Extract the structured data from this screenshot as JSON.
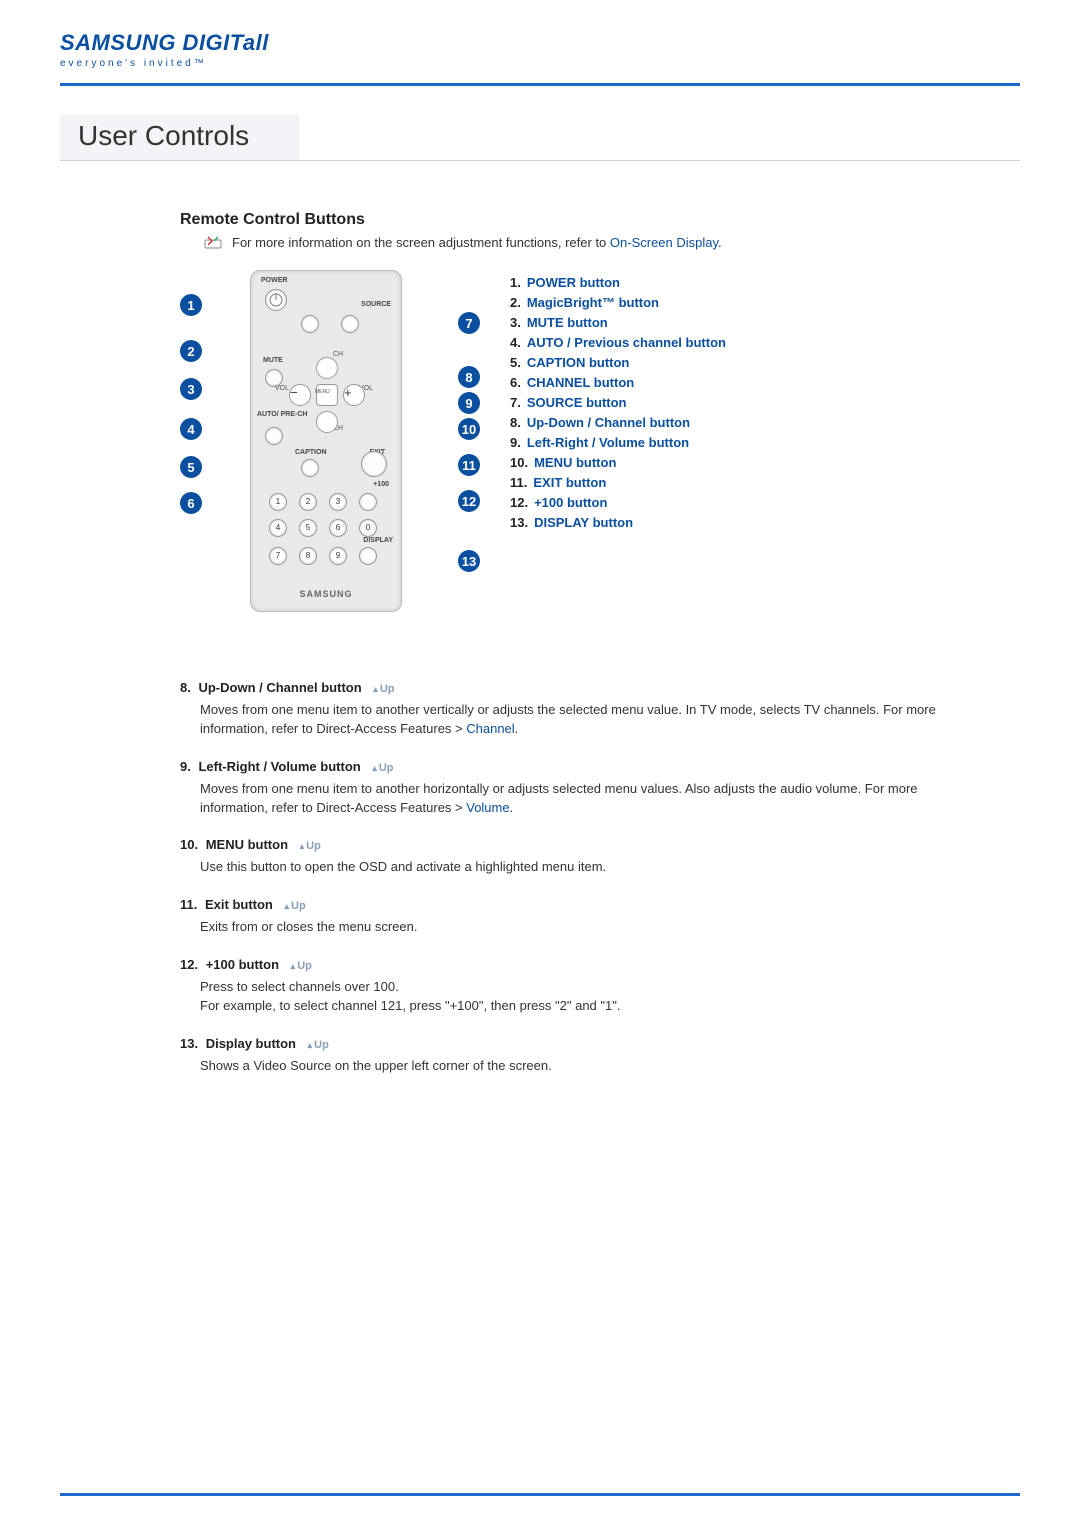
{
  "brand": {
    "logo_main": "SAMSUNG DIGITall",
    "logo_tag": "everyone's invited™"
  },
  "section_title": "User Controls",
  "subsection_title": "Remote Control Buttons",
  "note": {
    "text_before": "For more information on the screen adjustment functions, refer to ",
    "link": "On-Screen Display",
    "text_after": "."
  },
  "remote": {
    "label_power": "POWER",
    "label_source": "SOURCE",
    "label_mute": "MUTE",
    "label_auto": "AUTO/\nPRE-CH",
    "label_caption": "CAPTION",
    "label_exit": "EXIT",
    "label_plus100": "+100",
    "label_display": "DISPLAY",
    "label_ch": "CH",
    "label_vol": "VOL",
    "label_menu": "MENU",
    "brand": "SAMSUNG",
    "numpad": [
      "1",
      "2",
      "3",
      "4",
      "5",
      "6",
      "7",
      "8",
      "9",
      "0"
    ]
  },
  "callouts_left": [
    "1",
    "2",
    "3",
    "4",
    "5",
    "6"
  ],
  "callouts_right": [
    "7",
    "8",
    "9",
    "10",
    "11",
    "12",
    "13"
  ],
  "button_list": [
    {
      "n": "1.",
      "label": "POWER button"
    },
    {
      "n": "2.",
      "label": "MagicBright™ button"
    },
    {
      "n": "3.",
      "label": "MUTE button"
    },
    {
      "n": "4.",
      "label": "AUTO / Previous channel button"
    },
    {
      "n": "5.",
      "label": "CAPTION button"
    },
    {
      "n": "6.",
      "label": "CHANNEL button"
    },
    {
      "n": "7.",
      "label": "SOURCE button"
    },
    {
      "n": "8.",
      "label": "Up-Down / Channel button"
    },
    {
      "n": "9.",
      "label": "Left-Right / Volume button"
    },
    {
      "n": "10.",
      "label": "MENU button"
    },
    {
      "n": "11.",
      "label": "EXIT button"
    },
    {
      "n": "12.",
      "label": "+100 button"
    },
    {
      "n": "13.",
      "label": "DISPLAY button"
    }
  ],
  "up_label": "Up",
  "descriptions": [
    {
      "n": "8.",
      "title": "Up-Down / Channel button",
      "body_before": "Moves from one menu item to another vertically or adjusts the selected menu value. In TV mode, selects TV channels. For more information, refer to Direct-Access Features > ",
      "link": "Channel",
      "body_after": "."
    },
    {
      "n": "9.",
      "title": "Left-Right / Volume button",
      "body_before": "Moves from one menu item to another horizontally or adjusts selected menu values. Also adjusts the audio volume. For more information, refer to Direct-Access Features > ",
      "link": "Volume",
      "body_after": "."
    },
    {
      "n": "10.",
      "title": "MENU button",
      "body_before": "Use this button to open the OSD and activate a highlighted menu item.",
      "link": "",
      "body_after": ""
    },
    {
      "n": "11.",
      "title": "Exit button",
      "body_before": "Exits from or closes the menu screen.",
      "link": "",
      "body_after": ""
    },
    {
      "n": "12.",
      "title": "+100 button",
      "body_before": "Press to select channels over 100.\nFor example, to select channel 121, press \"+100\", then press \"2\" and \"1\".",
      "link": "",
      "body_after": ""
    },
    {
      "n": "13.",
      "title": "Display button",
      "body_before": "Shows a Video Source on the upper left corner of the screen.",
      "link": "",
      "body_after": ""
    }
  ]
}
